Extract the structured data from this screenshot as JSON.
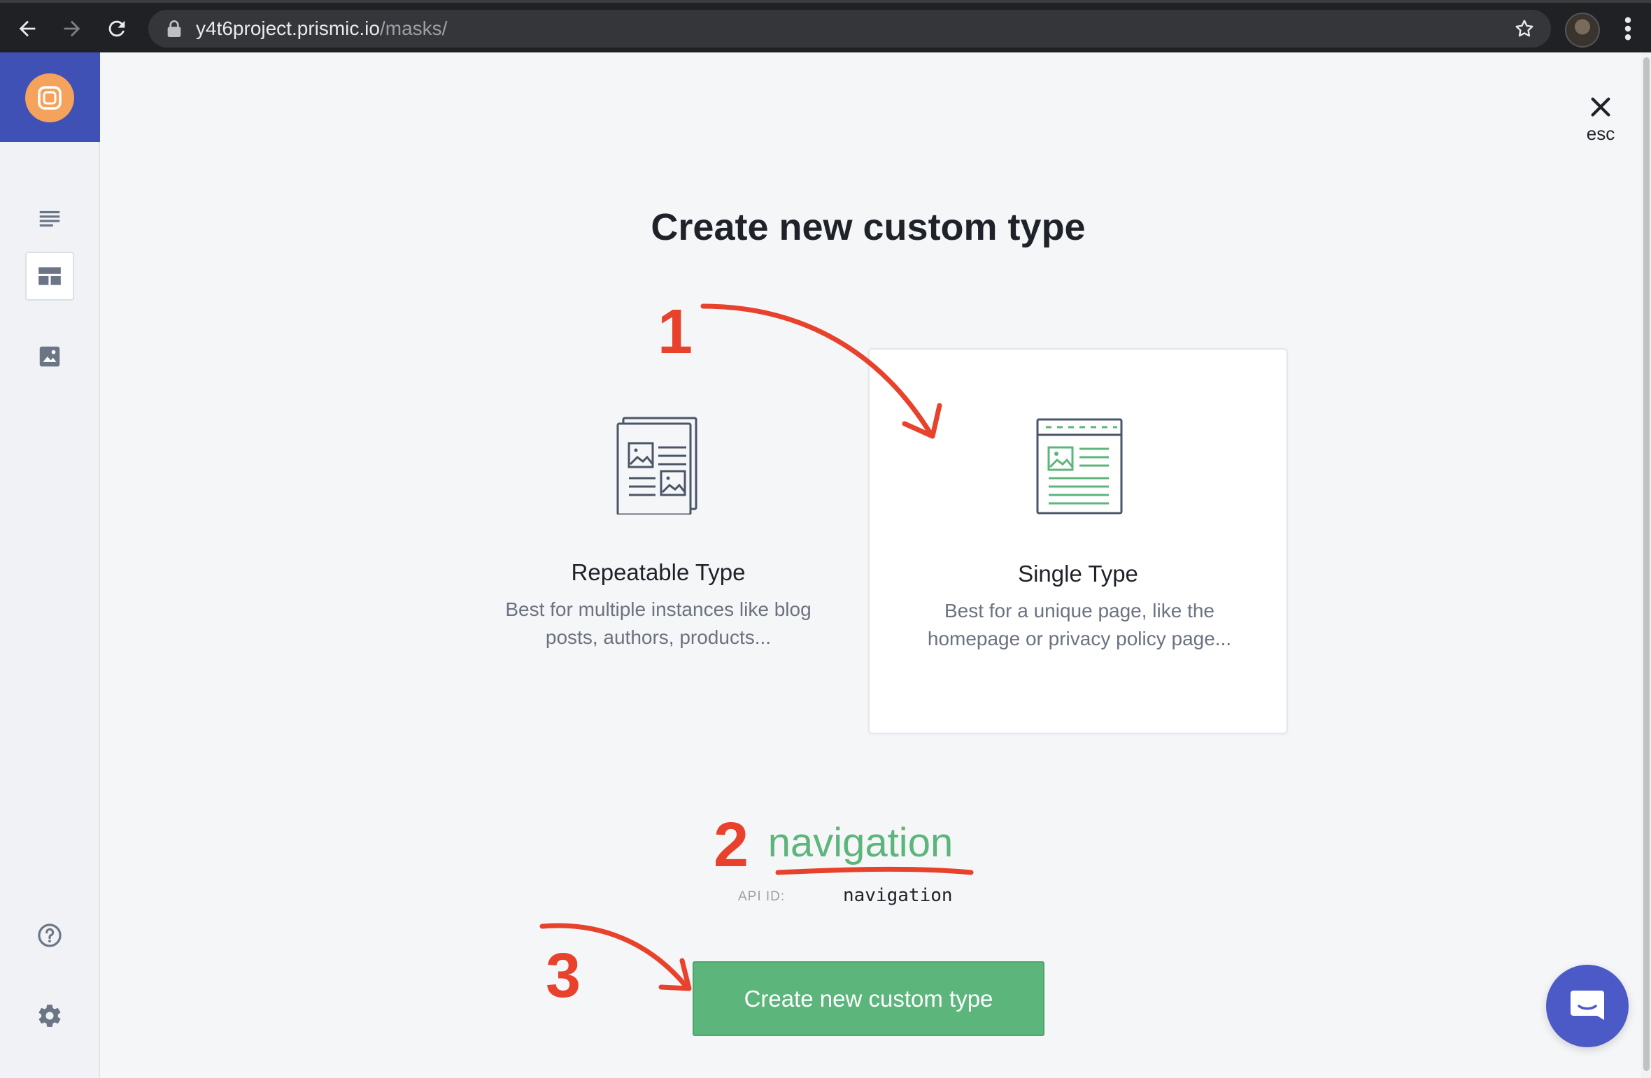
{
  "browser": {
    "url_host": "y4t6project.prismic.io",
    "url_path": "/masks/"
  },
  "rail": {
    "items": [
      {
        "icon": "documents-icon"
      },
      {
        "icon": "custom-types-icon",
        "active": true
      },
      {
        "icon": "media-icon"
      },
      {
        "icon": "help-icon"
      },
      {
        "icon": "settings-icon"
      }
    ]
  },
  "modal": {
    "close_label": "esc",
    "title": "Create new custom type",
    "types": [
      {
        "name": "Repeatable Type",
        "description": "Best for multiple instances like blog posts, authors, products..."
      },
      {
        "name": "Single Type",
        "description": "Best for a unique page, like the homepage or privacy policy page...",
        "selected": true
      }
    ],
    "name_value": "navigation",
    "api_id_label": "API ID:",
    "api_id_value": "navigation",
    "submit_label": "Create new custom type"
  },
  "annotations": [
    "1",
    "2",
    "3"
  ],
  "colors": {
    "brand": "#3f51b5",
    "accent_green": "#5cb57b",
    "annotation_red": "#e8412c",
    "chat": "#4b5ac6"
  }
}
